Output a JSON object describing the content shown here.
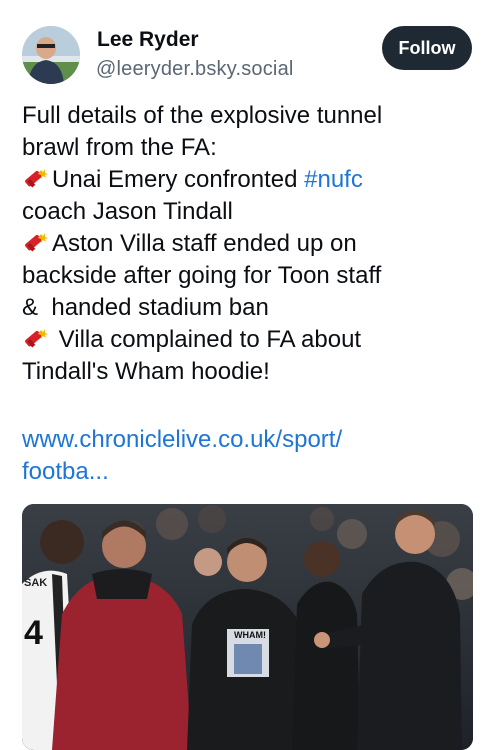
{
  "author": {
    "display_name": "Lee Ryder",
    "handle": "@leeryder.bsky.social",
    "avatar_icon": "user-avatar-photo"
  },
  "follow_label": "Follow",
  "post": {
    "lines": [
      "Full details of the explosive tunnel",
      "brawl from the FA:",
      "Unai Emery confronted ",
      "#nufc",
      "coach Jason Tindall",
      "Aston Villa staff ended up on",
      "backside after going for Toon staff",
      "&  handed stadium ban",
      " Villa complained to FA about",
      "Tindall's Wham hoodie!"
    ],
    "bullet_icon": "firecracker-icon"
  },
  "link": {
    "line1": "www.chroniclelive.co.uk/sport/",
    "line2": "footba..."
  },
  "media": {
    "shirt_text": "SAK",
    "shirt_number": "4",
    "hoodie_text": "WHAM!"
  },
  "colors": {
    "link": "#1d76d6",
    "follow_bg": "#1f2933",
    "handle": "#5a6775"
  }
}
